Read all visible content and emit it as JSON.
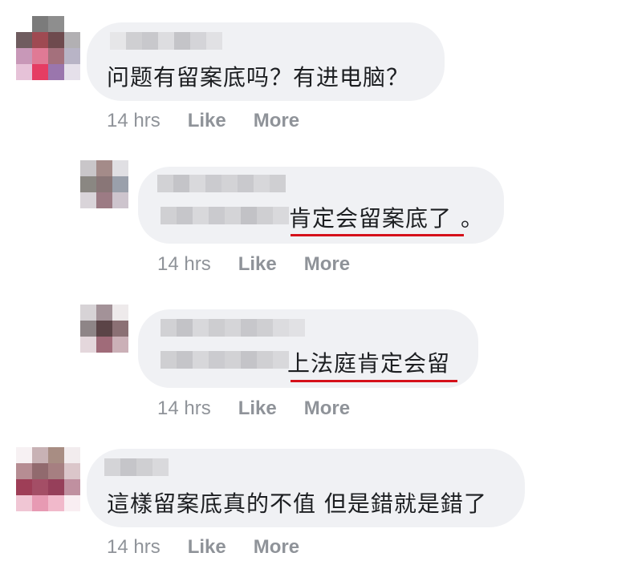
{
  "comments": [
    {
      "text_main": "问题有留案底吗？有进电脑？",
      "time": "14 hrs",
      "like": "Like",
      "more": "More"
    },
    {
      "text_main": "肯定会留案底了",
      "text_tail": "。",
      "time": "14 hrs",
      "like": "Like",
      "more": "More"
    },
    {
      "text_main": "上法庭肯定会留",
      "time": "14 hrs",
      "like": "Like",
      "more": "More"
    },
    {
      "text_main": "這樣留案底真的不值 但是錯就是錯了",
      "time": "14 hrs",
      "like": "Like",
      "more": "More"
    }
  ],
  "colors": {
    "bubble": "#f0f1f4",
    "meta_text": "#8f9399",
    "underline": "#d5101a"
  }
}
